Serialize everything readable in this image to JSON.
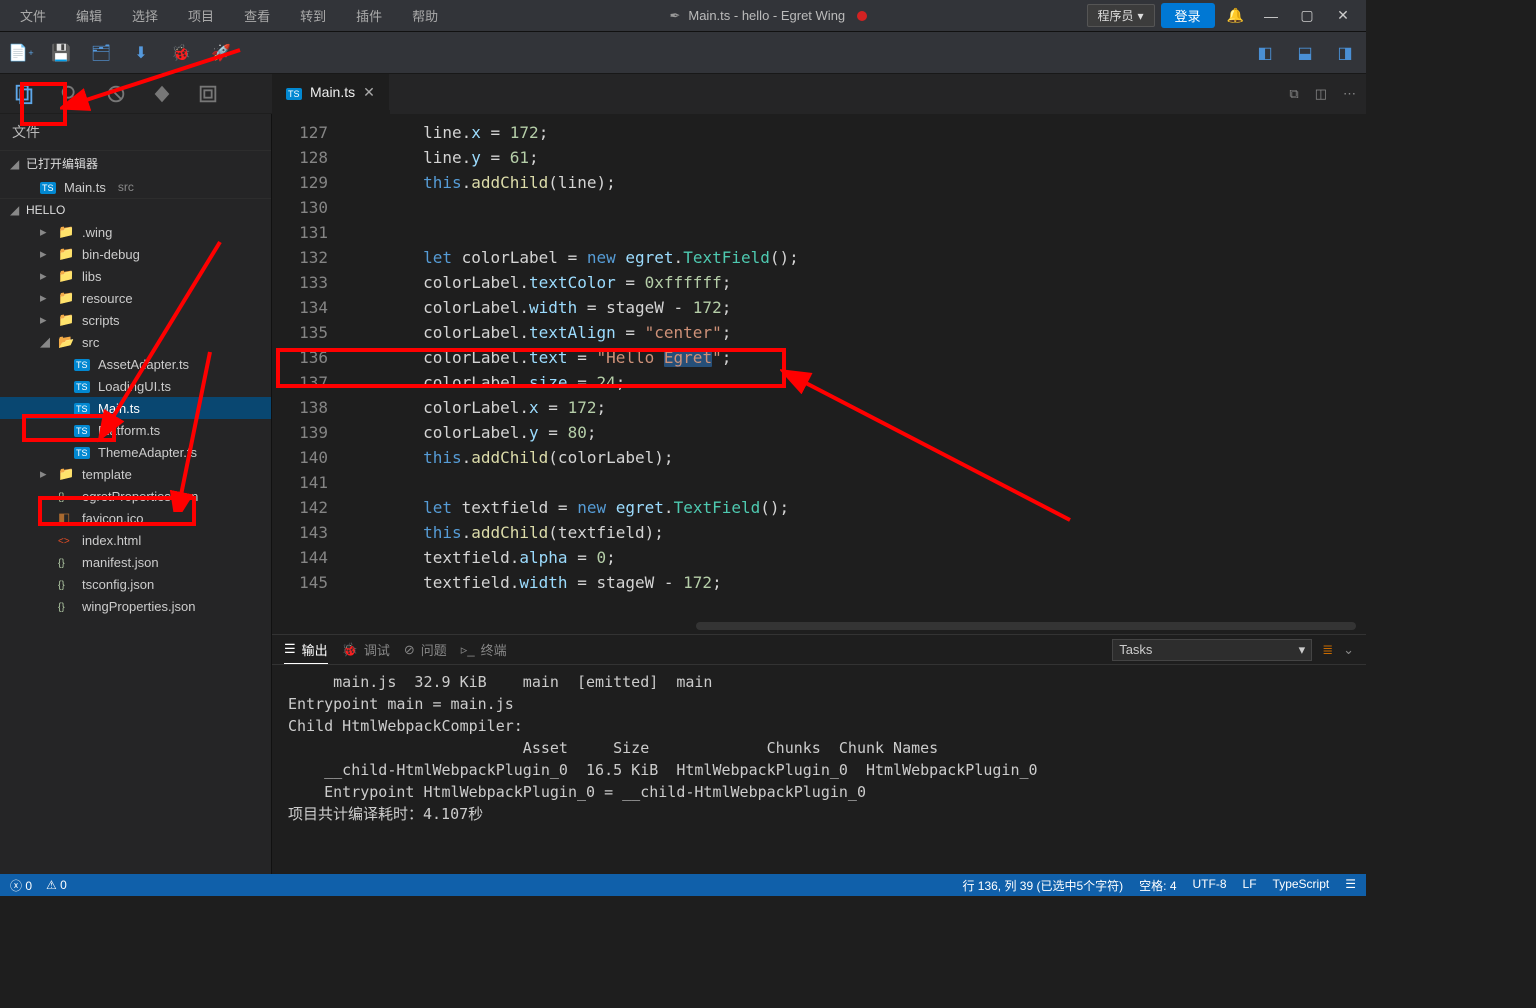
{
  "menu": [
    "文件",
    "编辑",
    "选择",
    "项目",
    "查看",
    "转到",
    "插件",
    "帮助"
  ],
  "title": "Main.ts - hello - Egret Wing",
  "programmer_label": "程序员",
  "login_label": "登录",
  "sidebar": {
    "title": "文件",
    "open_editors": "已打开编辑器",
    "open_editor_item": "Main.ts",
    "open_editor_suffix": "src",
    "project": "HELLO",
    "folders": [
      ".wing",
      "bin-debug",
      "libs",
      "resource",
      "scripts"
    ],
    "src": "src",
    "src_files": [
      "AssetAdapter.ts",
      "LoadingUI.ts",
      "Main.ts",
      "Platform.ts",
      "ThemeAdapter.ts"
    ],
    "template": "template",
    "root_files": [
      {
        "n": "egretProperties.json",
        "t": "json"
      },
      {
        "n": "favicon.ico",
        "t": "ico"
      },
      {
        "n": "index.html",
        "t": "html"
      },
      {
        "n": "manifest.json",
        "t": "json"
      },
      {
        "n": "tsconfig.json",
        "t": "json"
      },
      {
        "n": "wingProperties.json",
        "t": "json"
      }
    ]
  },
  "tab": {
    "name": "Main.ts"
  },
  "code_lines": [
    {
      "n": 127,
      "h": "line.<span class='prop'>x</span> = <span class='num'>172</span>;"
    },
    {
      "n": 128,
      "h": "line.<span class='prop'>y</span> = <span class='num'>61</span>;"
    },
    {
      "n": 129,
      "h": "<span class='this'>this</span>.<span class='fn'>addChild</span>(line);"
    },
    {
      "n": 130,
      "h": ""
    },
    {
      "n": 131,
      "h": ""
    },
    {
      "n": 132,
      "h": "<span class='kw'>let</span> colorLabel = <span class='kw'>new</span> <span class='prop'>egret</span>.<span class='cls'>TextField</span>();"
    },
    {
      "n": 133,
      "h": "colorLabel.<span class='prop'>textColor</span> = <span class='num'>0xffffff</span>;"
    },
    {
      "n": 134,
      "h": "colorLabel.<span class='prop'>width</span> = stageW - <span class='num'>172</span>;"
    },
    {
      "n": 135,
      "h": "colorLabel.<span class='prop'>textAlign</span> = <span class='str'>\"center\"</span>;"
    },
    {
      "n": 136,
      "h": "colorLabel.<span class='prop'>text</span> = <span class='str'>\"Hello <span class='sel-bg'>Egret</span>\"</span>;"
    },
    {
      "n": 137,
      "h": "colorLabel.<span class='prop'>size</span> = <span class='num'>24</span>;"
    },
    {
      "n": 138,
      "h": "colorLabel.<span class='prop'>x</span> = <span class='num'>172</span>;"
    },
    {
      "n": 139,
      "h": "colorLabel.<span class='prop'>y</span> = <span class='num'>80</span>;"
    },
    {
      "n": 140,
      "h": "<span class='this'>this</span>.<span class='fn'>addChild</span>(colorLabel);"
    },
    {
      "n": 141,
      "h": ""
    },
    {
      "n": 142,
      "h": "<span class='kw'>let</span> textfield = <span class='kw'>new</span> <span class='prop'>egret</span>.<span class='cls'>TextField</span>();"
    },
    {
      "n": 143,
      "h": "<span class='this'>this</span>.<span class='fn'>addChild</span>(textfield);"
    },
    {
      "n": 144,
      "h": "textfield.<span class='prop'>alpha</span> = <span class='num'>0</span>;"
    },
    {
      "n": 145,
      "h": "textfield.<span class='prop'>width</span> = stageW - <span class='num'>172</span>;"
    }
  ],
  "panel": {
    "tabs": {
      "output": "输出",
      "debug": "调试",
      "problems": "问题",
      "terminal": "终端"
    },
    "task_select": "Tasks",
    "body": "     main.js  32.9 KiB    main  [emitted]  main\nEntrypoint main = main.js\nChild HtmlWebpackCompiler:\n                          Asset     Size             Chunks  Chunk Names\n    __child-HtmlWebpackPlugin_0  16.5 KiB  HtmlWebpackPlugin_0  HtmlWebpackPlugin_0\n    Entrypoint HtmlWebpackPlugin_0 = __child-HtmlWebpackPlugin_0\n项目共计编译耗时：4.107秒"
  },
  "status": {
    "errors": "0",
    "warnings": "0",
    "cursor": "行 136, 列 39 (已选中5个字符)",
    "spaces": "空格: 4",
    "encoding": "UTF-8",
    "eol": "LF",
    "lang": "TypeScript"
  }
}
